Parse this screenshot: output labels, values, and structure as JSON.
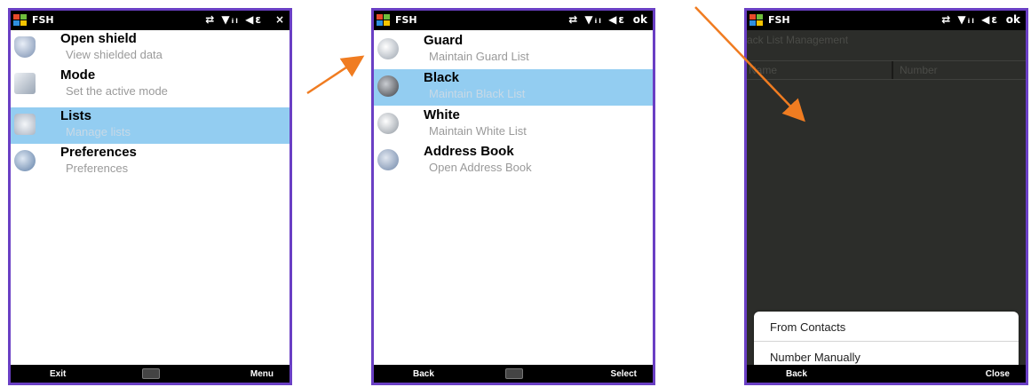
{
  "colors": {
    "frame": "#6a3fc4",
    "selected": "#93cdf1",
    "arrow": "#f07c21",
    "dark_bg": "#2c2d2a"
  },
  "screens": [
    {
      "status": {
        "app": "FSH",
        "icons": "⇄ ▼ᵢₗ ◀ε",
        "action": "×"
      },
      "items": [
        {
          "title": "Open shield",
          "subtitle": "View shielded data",
          "icon": "shield-icon",
          "selected": false
        },
        {
          "title": "Mode",
          "subtitle": "Set the active mode",
          "icon": "mode-icon",
          "selected": false
        },
        {
          "title": "Lists",
          "subtitle": "Manage lists",
          "icon": "lists-icon",
          "selected": true
        },
        {
          "title": "Preferences",
          "subtitle": "Preferences",
          "icon": "preferences-icon",
          "selected": false
        }
      ],
      "softkeys": {
        "left": "Exit",
        "right": "Menu"
      }
    },
    {
      "status": {
        "app": "FSH",
        "icons": "⇄ ▼ᵢₗ ◀ε",
        "action": "ok"
      },
      "items": [
        {
          "title": "Guard",
          "subtitle": "Maintain Guard List",
          "icon": "guard-icon",
          "selected": false
        },
        {
          "title": "Black",
          "subtitle": "Maintain Black List",
          "icon": "black-list-icon",
          "selected": true
        },
        {
          "title": "White",
          "subtitle": "Maintain White List",
          "icon": "white-list-icon",
          "selected": false
        },
        {
          "title": "Address Book",
          "subtitle": "Open Address Book",
          "icon": "address-book-icon",
          "selected": false
        }
      ],
      "softkeys": {
        "left": "Back",
        "right": "Select"
      }
    },
    {
      "status": {
        "app": "FSH",
        "icons": "⇄ ▼ᵢₗ ◀ε",
        "action": "ok"
      },
      "title": "ack List Management",
      "columns": [
        "Name",
        "Number"
      ],
      "popup": [
        "From Contacts",
        "Number Manually"
      ],
      "softkeys": {
        "left": "Back",
        "right": "Close"
      }
    }
  ]
}
